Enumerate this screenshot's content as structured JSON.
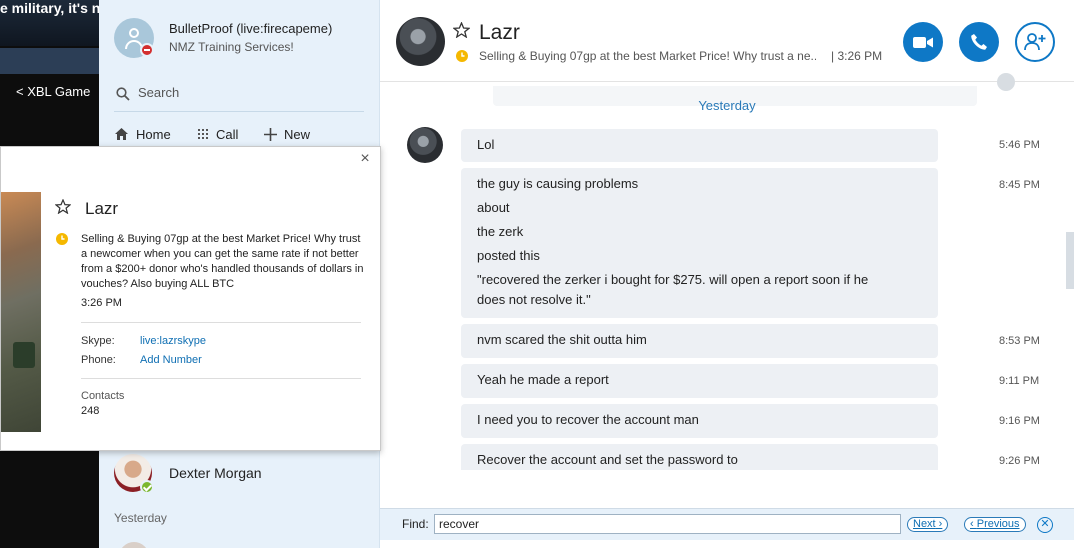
{
  "background": {
    "page_text": "e military, it's n",
    "xbl_link": "< XBL Game"
  },
  "sidebar": {
    "profile": {
      "name": "BulletProof (live:firecapeme)",
      "status": "NMZ Training Services!"
    },
    "search_placeholder": "Search",
    "nav": {
      "home": "Home",
      "call": "Call",
      "new": "New"
    },
    "contacts": [
      {
        "name": "Dexter Morgan"
      }
    ],
    "section_yesterday": "Yesterday"
  },
  "popup": {
    "name": "Lazr",
    "mood": "Selling & Buying 07gp at the best Market Price! Why trust a newcomer when you can get the same rate if not better from a $200+ donor who's handled thousands of dollars in vouches? Also buying ALL BTC",
    "mood_time": "3:26 PM",
    "skype_label": "Skype:",
    "skype_value": "live:lazrskype",
    "phone_label": "Phone:",
    "phone_value": "Add Number",
    "contacts_label": "Contacts",
    "contacts_count": "248",
    "close_glyph": "×"
  },
  "chat": {
    "name": "Lazr",
    "mood": "Selling & Buying 07gp at the best Market Price! Why trust a ne...",
    "mood_time": "| 3:26 PM",
    "day_separator": "Yesterday",
    "messages": [
      {
        "lines": [
          "Lol"
        ],
        "time": "5:46 PM"
      },
      {
        "lines": [
          "the guy is causing problems",
          "about",
          "the zerk",
          "posted this",
          "\"recovered the zerker i bought for $275. will open a report soon if he",
          "does not resolve it.\""
        ],
        "time": "8:45 PM"
      },
      {
        "lines": [
          "nvm scared the shit outta him"
        ],
        "time": "8:53 PM"
      },
      {
        "lines": [
          "Yeah he made a report"
        ],
        "time": "9:11 PM"
      },
      {
        "lines": [
          "I need you to recover the account man"
        ],
        "time": "9:16 PM"
      },
      {
        "lines": [
          "Recover the account and set the password to"
        ],
        "time": "9:26 PM"
      }
    ]
  },
  "findbar": {
    "label": "Find:",
    "value": "recover",
    "next": "Next",
    "previous": "Previous"
  },
  "colors": {
    "accent": "#0e78c6",
    "sidebar_bg": "#e7f1fa",
    "bubble_bg": "#edf0f4",
    "mood_icon": "#f5b800",
    "online": "#7bb72f",
    "dnd": "#d32f2f"
  },
  "icons": [
    "search-icon",
    "home-icon",
    "dialpad-icon",
    "plus-icon",
    "star-icon",
    "mood-clock-icon",
    "video-icon",
    "phone-icon",
    "add-person-icon",
    "close-icon"
  ]
}
